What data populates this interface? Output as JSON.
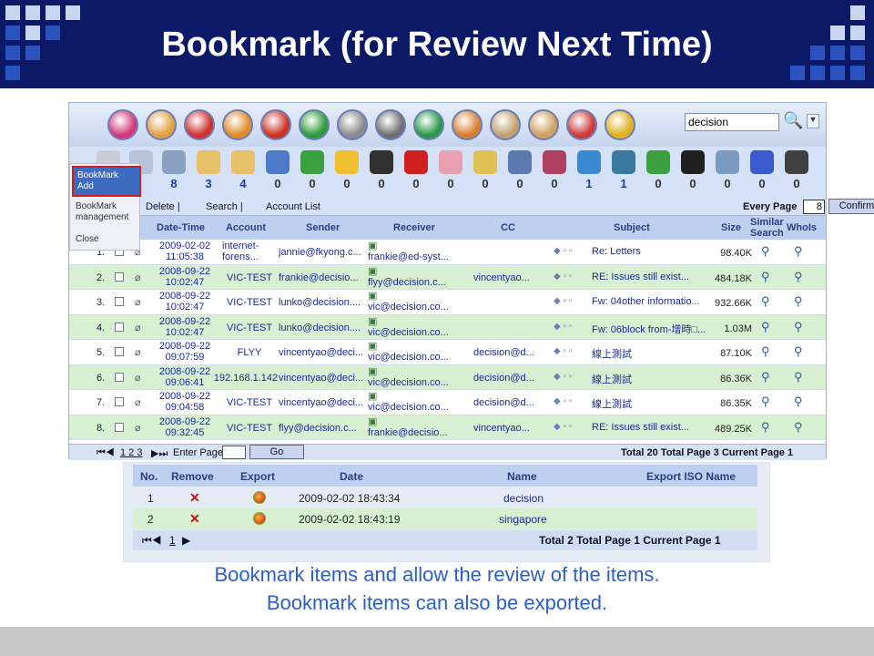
{
  "slide": {
    "title": "Bookmark (for Review Next Time)",
    "caption_line1": "Bookmark items and allow the review of the items.",
    "caption_line2": "Bookmark items can also be exported."
  },
  "toolbar": {
    "search_value": "decision",
    "counts": [
      "0",
      "8",
      "3",
      "4",
      "0",
      "0",
      "0",
      "0",
      "0",
      "0",
      "0",
      "0",
      "0",
      "0",
      "0",
      "1",
      "1",
      "0",
      "0",
      "0",
      "0",
      "0"
    ]
  },
  "bookmark_menu": {
    "add": "BookMark Add",
    "management": "BookMark management",
    "close": "Close"
  },
  "list_toolbar": {
    "delete": "Delete |",
    "search": "Search |",
    "account_list": "Account List",
    "every_page_label": "Every Page",
    "every_page_value": "8",
    "confirm": "Confirm"
  },
  "table": {
    "headers": {
      "datetime": "Date-Time",
      "account": "Account",
      "sender": "Sender",
      "receiver": "Receiver",
      "cc": "CC",
      "subject": "Subject",
      "size": "Size",
      "similar": "Similar Search",
      "whois": "WhoIs"
    },
    "rows": [
      {
        "num": "1.",
        "date": "2009-02-02",
        "time": "11:05:38",
        "account": "internet-",
        "account2": "forens...",
        "sender": "jannie@fkyong.c...",
        "receiver": "frankie@ed-syst...",
        "cc": "",
        "subject": "Re: Letters",
        "size": "98.40K"
      },
      {
        "num": "2.",
        "date": "2008-09-22",
        "time": "10:02:47",
        "account": "VIC-TEST",
        "account2": "",
        "sender": "frankie@decisio...",
        "receiver": "flyy@decision.c...",
        "cc": "vincentyao...",
        "subject": "RE: Issues still exist...",
        "size": "484.18K"
      },
      {
        "num": "3.",
        "date": "2008-09-22",
        "time": "10:02:47",
        "account": "VIC-TEST",
        "account2": "",
        "sender": "lunko@decision....",
        "receiver": "vic@decision.co...",
        "cc": "",
        "subject": "Fw: 04other informatio...",
        "size": "932.66K"
      },
      {
        "num": "4.",
        "date": "2008-09-22",
        "time": "10:02:47",
        "account": "VIC-TEST",
        "account2": "",
        "sender": "lunko@decision....",
        "receiver": "vic@decision.co...",
        "cc": "",
        "subject": "Fw: 06block from-增時□...",
        "size": "1.03M"
      },
      {
        "num": "5.",
        "date": "2008-09-22",
        "time": "09:07:59",
        "account": "FLYY",
        "account2": "",
        "sender": "vincentyao@deci...",
        "receiver": "vic@decision.co...",
        "cc": "decision@d...",
        "subject": "線上測試",
        "size": "87.10K"
      },
      {
        "num": "6.",
        "date": "2008-09-22",
        "time": "09:06:41",
        "account": "192.168.1.142",
        "account2": "",
        "sender": "vincentyao@deci...",
        "receiver": "vic@decision.co...",
        "cc": "decision@d...",
        "subject": "線上測試",
        "size": "86.36K"
      },
      {
        "num": "7.",
        "date": "2008-09-22",
        "time": "09:04:58",
        "account": "VIC-TEST",
        "account2": "",
        "sender": "vincentyao@deci...",
        "receiver": "vic@decision.co...",
        "cc": "decision@d...",
        "subject": "線上測試",
        "size": "86.35K"
      },
      {
        "num": "8.",
        "date": "2008-09-22",
        "time": "09:32:45",
        "account": "VIC-TEST",
        "account2": "",
        "sender": "flyy@decision.c...",
        "receiver": "frankie@decisio...",
        "cc": "vincentyao...",
        "subject": "RE: Issues still exist...",
        "size": "489.25K"
      }
    ]
  },
  "pager": {
    "first": "⏮◀",
    "pages": "1 2 3",
    "next": "▶⏭",
    "enter_page": "Enter Page",
    "go": "Go",
    "summary": "Total 20  Total Page 3  Current Page 1"
  },
  "bookmarks": {
    "headers": {
      "no": "No.",
      "remove": "Remove",
      "export": "Export",
      "date": "Date",
      "name": "Name",
      "export_iso": "Export ISO Name"
    },
    "rows": [
      {
        "no": "1",
        "date": "2009-02-02 18:43:34",
        "name": "decision"
      },
      {
        "no": "2",
        "date": "2009-02-02 18:43:19",
        "name": "singapore"
      }
    ],
    "footer_nav": "⏮◀",
    "footer_page": "1",
    "footer_next": "▶",
    "summary": "Total 2  Total Page 1  Current Page 1"
  }
}
